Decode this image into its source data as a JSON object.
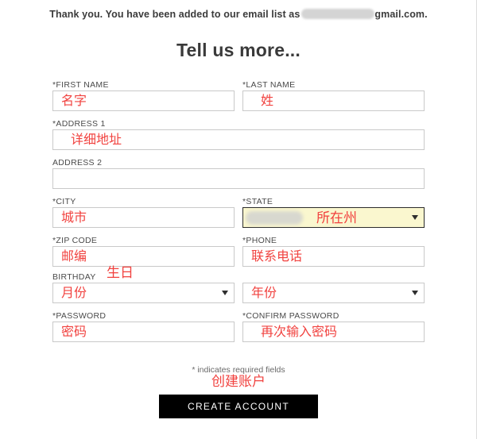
{
  "banner": {
    "text_before": "Thank you. You have been added to our email list as",
    "redacted": true,
    "text_after": "gmail.com."
  },
  "heading": "Tell us more...",
  "form": {
    "first_name": {
      "label": "*FIRST NAME",
      "annotation": "名字",
      "value": ""
    },
    "last_name": {
      "label": "*LAST NAME",
      "annotation": "姓",
      "value": ""
    },
    "address1": {
      "label": "*ADDRESS 1",
      "annotation": "详细地址",
      "value": ""
    },
    "address2": {
      "label": "ADDRESS 2",
      "annotation": "",
      "value": ""
    },
    "city": {
      "label": "*CITY",
      "annotation": "城市",
      "value": ""
    },
    "state": {
      "label": "*STATE",
      "annotation": "所在州",
      "value": "",
      "autofilled": true
    },
    "zip": {
      "label": "*ZIP CODE",
      "annotation": "邮编",
      "value": ""
    },
    "phone": {
      "label": "*PHONE",
      "annotation": "联系电话",
      "value": ""
    },
    "birthday": {
      "label": "BIRTHDAY",
      "annotation": "生日"
    },
    "birth_month": {
      "annotation": "月份",
      "value": ""
    },
    "birth_year": {
      "annotation": "年份",
      "value": ""
    },
    "password": {
      "label": "*PASSWORD",
      "annotation": "密码",
      "value": ""
    },
    "confirm_password": {
      "label": "*CONFIRM PASSWORD",
      "annotation": "再次输入密码",
      "value": ""
    }
  },
  "footer": {
    "required_note": "* indicates required fields",
    "submit_annotation": "创建账户",
    "submit_label": "CREATE ACCOUNT"
  },
  "colors": {
    "annotation_red": "#f1423f",
    "autofill_yellow": "#faf7cf",
    "button_black": "#000000",
    "field_border": "#c9c9c9"
  }
}
